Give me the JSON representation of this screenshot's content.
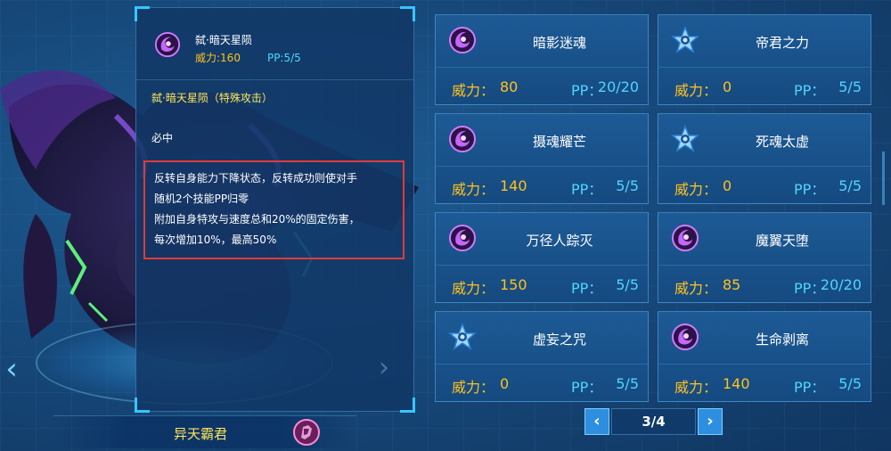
{
  "detail": {
    "name": "弑·暗天星陨",
    "power_label": "威力:160",
    "pp_label": "PP:5/5",
    "type_line": "弑·暗天星陨（特殊攻击）",
    "sure_hit": "必中",
    "description_lines": [
      "反转自身能力下降状态，反转成功则使对手",
      "随机2个技能PP归零",
      "附加自身特攻与速度总和20%的固定伤害，",
      "每次增加10%，最高50%"
    ]
  },
  "pet": {
    "name": "异天霸君"
  },
  "skills": [
    {
      "name": "暗影迷魂",
      "power_label": "威力：",
      "power": "80",
      "pp_label": "PP：",
      "pp": "20/20",
      "icon": "shadow-orb-icon"
    },
    {
      "name": "帝君之力",
      "power_label": "威力：",
      "power": "0",
      "pp_label": "PP：",
      "pp": "5/5",
      "icon": "star-buff-icon"
    },
    {
      "name": "摄魂耀芒",
      "power_label": "威力：",
      "power": "140",
      "pp_label": "PP：",
      "pp": "5/5",
      "icon": "shadow-orb-icon"
    },
    {
      "name": "死魂太虚",
      "power_label": "威力：",
      "power": "0",
      "pp_label": "PP：",
      "pp": "5/5",
      "icon": "star-buff-icon"
    },
    {
      "name": "万径人踪灭",
      "power_label": "威力：",
      "power": "150",
      "pp_label": "PP：",
      "pp": "5/5",
      "icon": "shadow-orb-icon"
    },
    {
      "name": "魔翼天堕",
      "power_label": "威力：",
      "power": "85",
      "pp_label": "PP：",
      "pp": "20/20",
      "icon": "shadow-orb-icon"
    },
    {
      "name": "虚妄之咒",
      "power_label": "威力：",
      "power": "0",
      "pp_label": "PP：",
      "pp": "5/5",
      "icon": "star-buff-icon"
    },
    {
      "name": "生命剥离",
      "power_label": "威力：",
      "power": "140",
      "pp_label": "PP：",
      "pp": "5/5",
      "icon": "shadow-orb-icon"
    }
  ],
  "pager": {
    "text": "3/4",
    "prev": "‹",
    "next": "›",
    "left_arrow": "‹",
    "detail_arrow": "›"
  },
  "colors": {
    "power": "#ffc21e",
    "pp": "#4fd6ff",
    "highlight_border": "#e03a3a"
  }
}
